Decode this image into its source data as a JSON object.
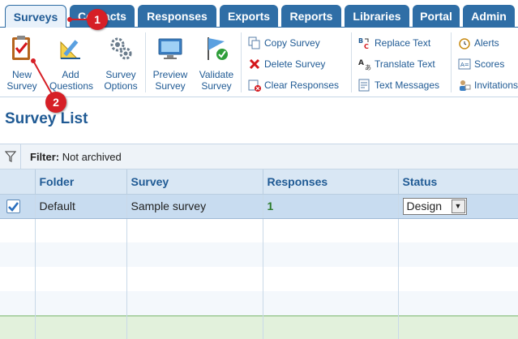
{
  "tabs": [
    {
      "label": "Surveys",
      "active": true
    },
    {
      "label": "Contacts",
      "active": false
    },
    {
      "label": "Responses",
      "active": false
    },
    {
      "label": "Exports",
      "active": false
    },
    {
      "label": "Reports",
      "active": false
    },
    {
      "label": "Libraries",
      "active": false
    },
    {
      "label": "Portal",
      "active": false
    },
    {
      "label": "Admin",
      "active": false
    }
  ],
  "toolbar": {
    "new_survey": "New\nSurvey",
    "add_questions": "Add\nQuestions",
    "survey_options": "Survey\nOptions",
    "preview_survey": "Preview\nSurvey",
    "validate_survey": "Validate\nSurvey",
    "copy_survey": "Copy Survey",
    "delete_survey": "Delete Survey",
    "clear_responses": "Clear Responses",
    "replace_text": "Replace Text",
    "translate_text": "Translate Text",
    "text_messages": "Text Messages",
    "alerts": "Alerts",
    "scores": "Scores",
    "invitations": "Invitations"
  },
  "page_title": "Survey List",
  "filter": {
    "label": "Filter:",
    "value": "Not archived"
  },
  "table": {
    "columns": [
      "Folder",
      "Survey",
      "Responses",
      "Status"
    ],
    "rows": [
      {
        "folder": "Default",
        "survey": "Sample survey",
        "responses": "1",
        "status": "Design"
      }
    ]
  },
  "callouts": [
    "1",
    "2"
  ],
  "colors": {
    "accent": "#2f6ea6",
    "title": "#1f5a94",
    "callout": "#d61f26",
    "footer": "#e2f1dc"
  }
}
